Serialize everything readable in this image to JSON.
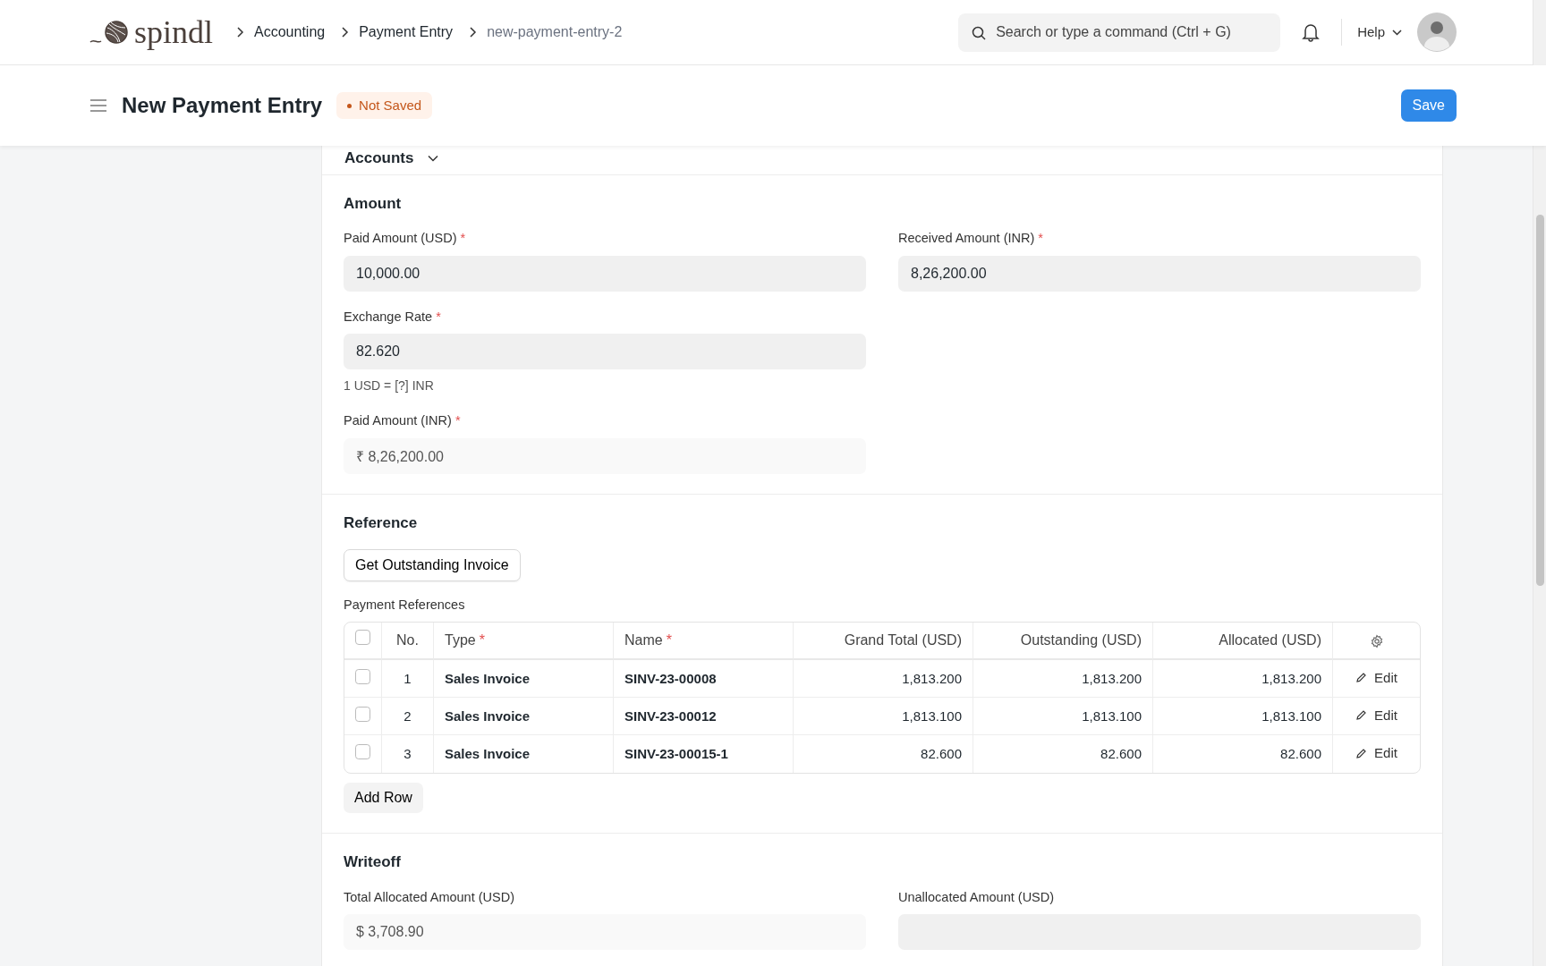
{
  "navbar": {
    "brand": "spindl",
    "breadcrumbs": [
      "Accounting",
      "Payment Entry",
      "new-payment-entry-2"
    ],
    "search": {
      "placeholder": "Search or type a command (Ctrl + G)"
    },
    "help": "Help"
  },
  "page": {
    "title": "New Payment Entry",
    "status": "Not Saved",
    "primary_action": "Save"
  },
  "sections": [
    {
      "kind": "collapsed",
      "title": "Accounts"
    },
    {
      "kind": "fields",
      "title": "Amount",
      "columns": [
        [
          {
            "label": "Paid Amount (USD)",
            "required_mark": "*",
            "value": "10,000.00",
            "read_only": false
          },
          {
            "label": "Exchange Rate",
            "required_mark": "*",
            "value": "82.620",
            "read_only": false,
            "description": "1 USD = [?] INR"
          },
          {
            "label": "Paid Amount (INR)",
            "required_mark": "*",
            "value": "₹ 8,26,200.00",
            "read_only": true
          }
        ],
        [
          {
            "label": "Received Amount (INR)",
            "required_mark": "*",
            "value": "8,26,200.00",
            "read_only": false
          }
        ]
      ]
    },
    {
      "kind": "table",
      "title": "Reference",
      "button": "Get Outstanding Invoice",
      "table_label": "Payment References",
      "select_all_checked": false,
      "columns": [
        {
          "label": "No."
        },
        {
          "label": "Type",
          "required_mark": "*"
        },
        {
          "label": "Name",
          "required_mark": "*"
        },
        {
          "label": "Grand Total (USD)"
        },
        {
          "label": "Outstanding (USD)"
        },
        {
          "label": "Allocated (USD)"
        }
      ],
      "rows": [
        {
          "checked": false,
          "cells": [
            "1",
            "Sales Invoice",
            "SINV-23-00008",
            "1,813.200",
            "1,813.200",
            "1,813.200"
          ],
          "edit": "Edit"
        },
        {
          "checked": false,
          "cells": [
            "2",
            "Sales Invoice",
            "SINV-23-00012",
            "1,813.100",
            "1,813.100",
            "1,813.100"
          ],
          "edit": "Edit"
        },
        {
          "checked": false,
          "cells": [
            "3",
            "Sales Invoice",
            "SINV-23-00015-1",
            "82.600",
            "82.600",
            "82.600"
          ],
          "edit": "Edit"
        }
      ],
      "add_row": "Add Row"
    },
    {
      "kind": "fields",
      "title": "Writeoff",
      "columns": [
        [
          {
            "label": "Total Allocated Amount (USD)",
            "value": "$ 3,708.90",
            "read_only": true
          }
        ],
        [
          {
            "label": "Unallocated Amount (USD)"
          }
        ]
      ]
    }
  ]
}
